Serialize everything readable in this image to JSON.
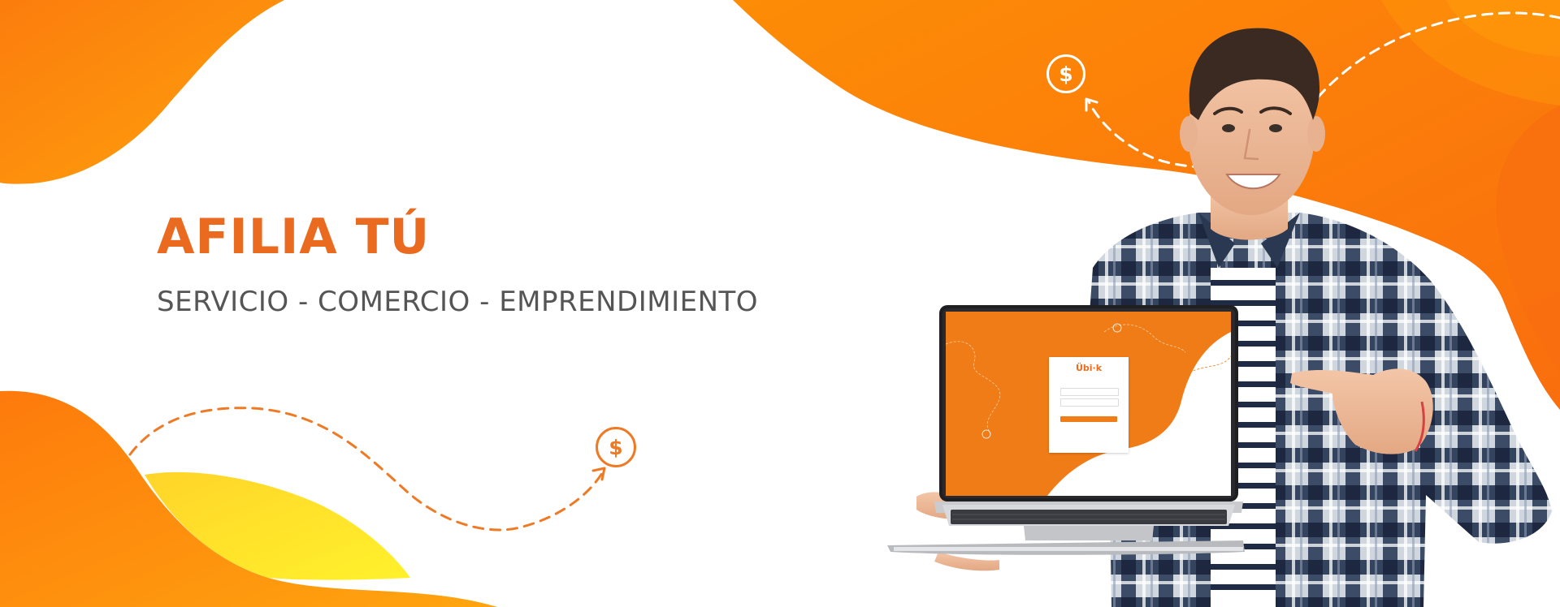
{
  "hero": {
    "title": "AFILIA TÚ",
    "subtitle": "SERVICIO - COMERCIO - EMPRENDIMIENTO"
  },
  "icons": {
    "coin_top": "dollar-coin-icon",
    "coin_bottom": "dollar-coin-icon",
    "coin_symbol": "$"
  },
  "laptop_screen": {
    "logo": "Übi·k"
  },
  "colors": {
    "accent": "#ea6a1f",
    "orange": "#fb8a08",
    "yellow": "#fde22a",
    "text_gray": "#555555"
  }
}
